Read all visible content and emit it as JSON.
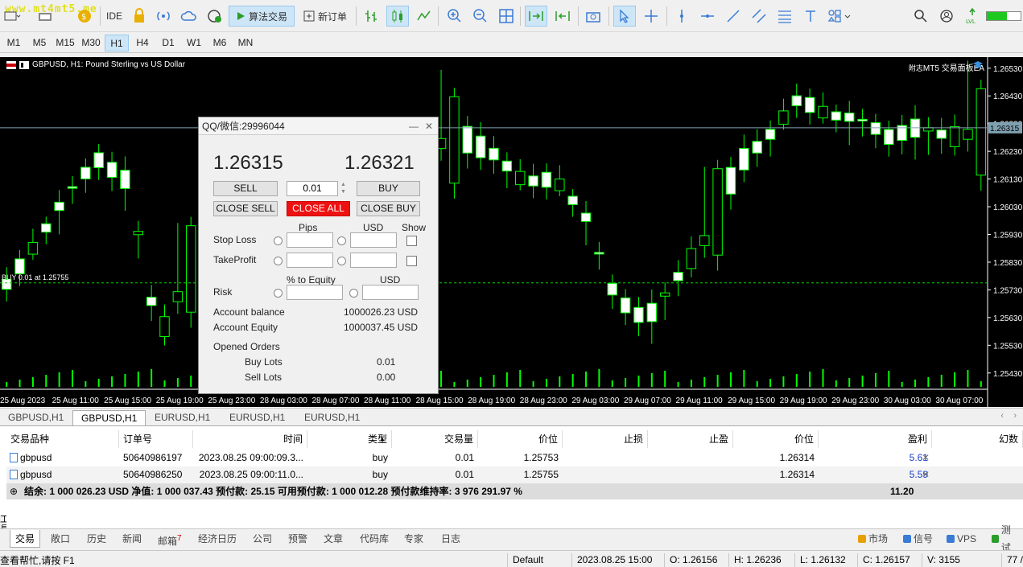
{
  "watermark": "www.mt4mt5.me",
  "toolbar": {
    "ide_label": "IDE",
    "algo_label": "算法交易",
    "new_order_label": "新订单"
  },
  "timeframes": [
    "M1",
    "M5",
    "M15",
    "M30",
    "H1",
    "H4",
    "D1",
    "W1",
    "M6",
    "MN"
  ],
  "active_timeframe": "H1",
  "chart": {
    "title": "GBPUSD, H1:  Pound Sterling vs US Dollar",
    "ea_name": "MT5 交易面板EA",
    "price_current": "1.26315",
    "trade_line_label": "BUY 0.01 at 1.25755",
    "colors": {
      "bg": "#000000",
      "bull": "#ffffff",
      "bear": "#000000",
      "wick": "#00ff00",
      "grid_line": "#7fa0b0"
    }
  },
  "chart_data": {
    "type": "candlestick",
    "symbol": "GBPUSD",
    "timeframe": "H1",
    "price_ticks": [
      "1.26530",
      "1.26430",
      "1.26330",
      "1.26230",
      "1.26130",
      "1.26030",
      "1.25930",
      "1.25830",
      "1.25730",
      "1.25630",
      "1.25530",
      "1.25430"
    ],
    "time_ticks": [
      "25 Aug 2023",
      "25 Aug 11:00",
      "25 Aug 15:00",
      "25 Aug 19:00",
      "25 Aug 23:00",
      "28 Aug 03:00",
      "28 Aug 07:00",
      "28 Aug 11:00",
      "28 Aug 15:00",
      "28 Aug 19:00",
      "28 Aug 23:00",
      "29 Aug 03:00",
      "29 Aug 07:00",
      "29 Aug 11:00",
      "29 Aug 15:00",
      "29 Aug 19:00",
      "29 Aug 23:00",
      "30 Aug 03:00",
      "30 Aug 07:00"
    ],
    "ylim": [
      1.2538,
      1.2657
    ],
    "bid_line": 1.26315,
    "buy_line": 1.25755,
    "candles": [
      [
        1.2568,
        1.2578,
        1.2564,
        1.2574
      ],
      [
        1.2574,
        1.2585,
        1.257,
        1.2583
      ],
      [
        1.2583,
        1.2578,
        1.2576,
        1.2576
      ],
      [
        1.2576,
        1.2582,
        1.2572,
        1.2581
      ],
      [
        1.2581,
        1.259,
        1.257,
        1.2586
      ],
      [
        1.2586,
        1.259,
        1.258,
        1.2587
      ],
      [
        1.2587,
        1.2596,
        1.2582,
        1.2594
      ],
      [
        1.2594,
        1.2605,
        1.259,
        1.2603
      ],
      [
        1.2603,
        1.2615,
        1.2598,
        1.2612
      ],
      [
        1.2612,
        1.2628,
        1.2602,
        1.2623
      ],
      [
        1.2623,
        1.2626,
        1.261,
        1.2621
      ],
      [
        1.2621,
        1.263,
        1.2615,
        1.2626
      ],
      [
        1.2626,
        1.2622,
        1.2612,
        1.2614
      ],
      [
        1.2614,
        1.2652,
        1.2612,
        1.2608
      ],
      [
        1.2608,
        1.261,
        1.255,
        1.2556
      ],
      [
        1.2556,
        1.2575,
        1.255,
        1.2572
      ],
      [
        1.2572,
        1.259,
        1.2568,
        1.2585
      ],
      [
        1.2585,
        1.2596,
        1.258,
        1.2592
      ],
      [
        1.2592,
        1.26,
        1.2585,
        1.2598
      ],
      [
        1.2598,
        1.2602,
        1.259,
        1.259
      ]
    ],
    "volume_bars": true
  },
  "panel": {
    "title": "QQ/微信:29996044",
    "bid": "1.26315",
    "ask": "1.26321",
    "sell_label": "SELL",
    "buy_label": "BUY",
    "lots": "0.01",
    "close_sell_label": "CLOSE SELL",
    "close_all_label": "CLOSE ALL",
    "close_buy_label": "CLOSE BUY",
    "pips_label": "Pips",
    "usd_label": "USD",
    "show_label": "Show",
    "stop_loss_label": "Stop Loss",
    "take_profit_label": "TakeProfit",
    "pct_equity_label": "% to Equity",
    "usd_label2": "USD",
    "risk_label": "Risk",
    "balance_label": "Account balance",
    "balance_value": "1000026.23 USD",
    "equity_label": "Account Equity",
    "equity_value": "1000037.45 USD",
    "opened_orders_label": "Opened Orders",
    "buy_lots_label": "Buy Lots",
    "buy_lots_value": "0.01",
    "sell_lots_label": "Sell Lots",
    "sell_lots_value": "0.00",
    "close_all_color": "#ee1111"
  },
  "chart_tabs": [
    "GBPUSD,H1",
    "GBPUSD,H1",
    "EURUSD,H1",
    "EURUSD,H1",
    "EURUSD,H1"
  ],
  "active_chart_tab": 1,
  "terminal": {
    "headers": [
      "交易品种",
      "订单号",
      "时间",
      "类型",
      "交易量",
      "价位",
      "止损",
      "止盈",
      "价位",
      "盈利",
      "幻数"
    ],
    "rows": [
      {
        "symbol": "gbpusd",
        "ticket": "50640986197",
        "time": "2023.08.25 09:00:09.3...",
        "type": "buy",
        "volume": "0.01",
        "price": "1.25753",
        "sl": "",
        "tp": "",
        "cur": "1.26314",
        "profit": "5.61"
      },
      {
        "symbol": "gbpusd",
        "ticket": "50640986250",
        "time": "2023.08.25 09:00:11.0...",
        "type": "buy",
        "volume": "0.01",
        "price": "1.25755",
        "sl": "",
        "tp": "",
        "cur": "1.26314",
        "profit": "5.59"
      }
    ],
    "summary": "结余: 1 000 026.23 USD  净值: 1 000 037.43  预付款: 25.15  可用预付款: 1 000 012.28  预付款维持率: 3 976 291.97 %",
    "summary_profit": "11.20"
  },
  "bottom_tabs": [
    "交易",
    "敞口",
    "历史",
    "新闻",
    "邮箱",
    "经济日历",
    "公司",
    "预警",
    "文章",
    "代码库",
    "专家",
    "日志"
  ],
  "mail_badge": "7",
  "bottom_right": {
    "market": "市场",
    "signals": "信号",
    "vps": "VPS",
    "tester": "测试"
  },
  "status": {
    "help": "查看帮忙,请按 F1",
    "profile": "Default",
    "datetime": "2023.08.25 15:00",
    "open": "O: 1.26156",
    "high": "H: 1.26236",
    "low": "L: 1.26132",
    "close": "C: 1.26157",
    "volume": "V: 3155",
    "ping": "77 /"
  }
}
